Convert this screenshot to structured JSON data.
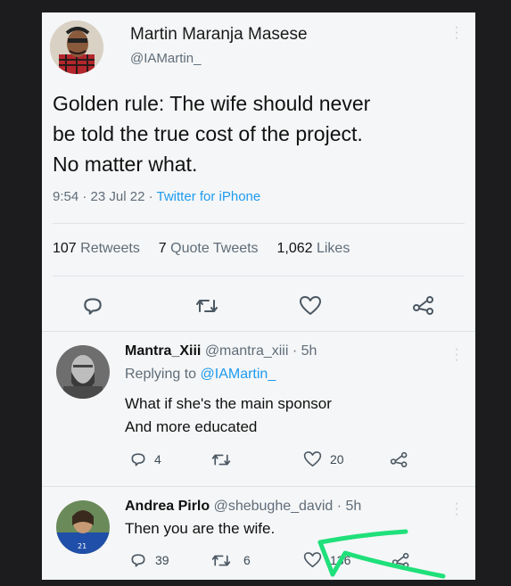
{
  "main_tweet": {
    "display_name": "Martin Maranja Masese",
    "handle": "@IAMartin_",
    "text_lines": [
      "Golden rule: The wife should never",
      "be told the true cost of the project.",
      "No matter what."
    ],
    "time": "9:54",
    "date": "23 Jul 22",
    "source": "Twitter for iPhone",
    "stats": {
      "retweets_count": "107",
      "retweets_label": "Retweets",
      "quotes_count": "7",
      "quotes_label": "Quote Tweets",
      "likes_count": "1,062",
      "likes_label": "Likes"
    },
    "actions": [
      "reply-icon",
      "retweet-icon",
      "like-icon",
      "share-icon"
    ]
  },
  "replies": [
    {
      "display_name": "Mantra_Xiii",
      "handle": "@mantra_xiii",
      "age": "5h",
      "replying_prefix": "Replying to",
      "replying_to": "@IAMartin_",
      "text_lines": [
        "What if she's the main sponsor",
        "And more educated"
      ],
      "reply_count": "4",
      "retweet_count": "",
      "like_count": "20"
    },
    {
      "display_name": "Andrea Pirlo",
      "handle": "@shebughe_david",
      "age": "5h",
      "text_lines": [
        "Then you are the wife."
      ],
      "reply_count": "39",
      "retweet_count": "6",
      "like_count": "136"
    }
  ],
  "annotation": {
    "type": "green-arrow",
    "color": "#1fe07a"
  },
  "colors": {
    "link": "#1d9bf0",
    "muted": "#5f6d79",
    "background": "#f5f6f7",
    "border": "#d7dde2"
  }
}
